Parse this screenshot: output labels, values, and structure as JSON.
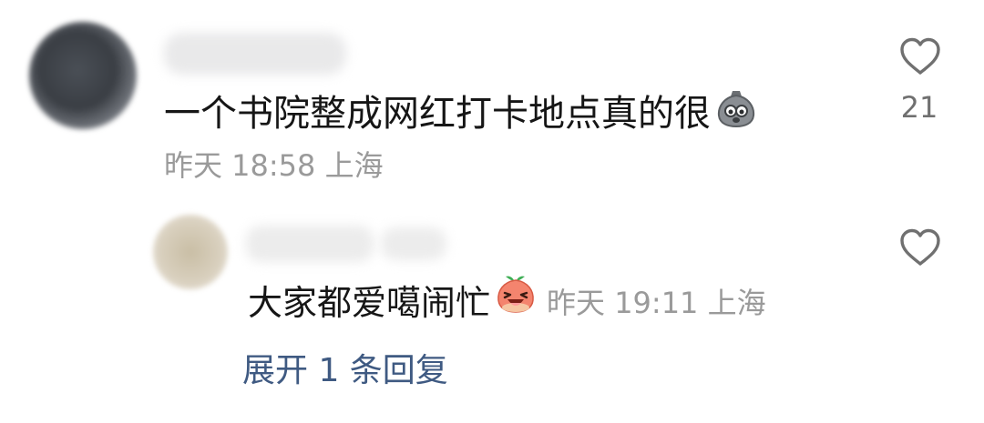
{
  "comment": {
    "text": "一个书院整成网红打卡地点真的很",
    "emoji": "crying-bag-emoji",
    "meta": "昨天 18:58 上海",
    "like_count": "21"
  },
  "reply": {
    "text": "大家都爱噶闹忙",
    "emoji": "laughing-peach-emoji",
    "meta": "昨天 19:11 上海"
  },
  "expand_label": "展开 1 条回复",
  "colors": {
    "text": "#161616",
    "meta": "#9a9a9a",
    "link": "#3f5a82",
    "icon": "#707070"
  }
}
